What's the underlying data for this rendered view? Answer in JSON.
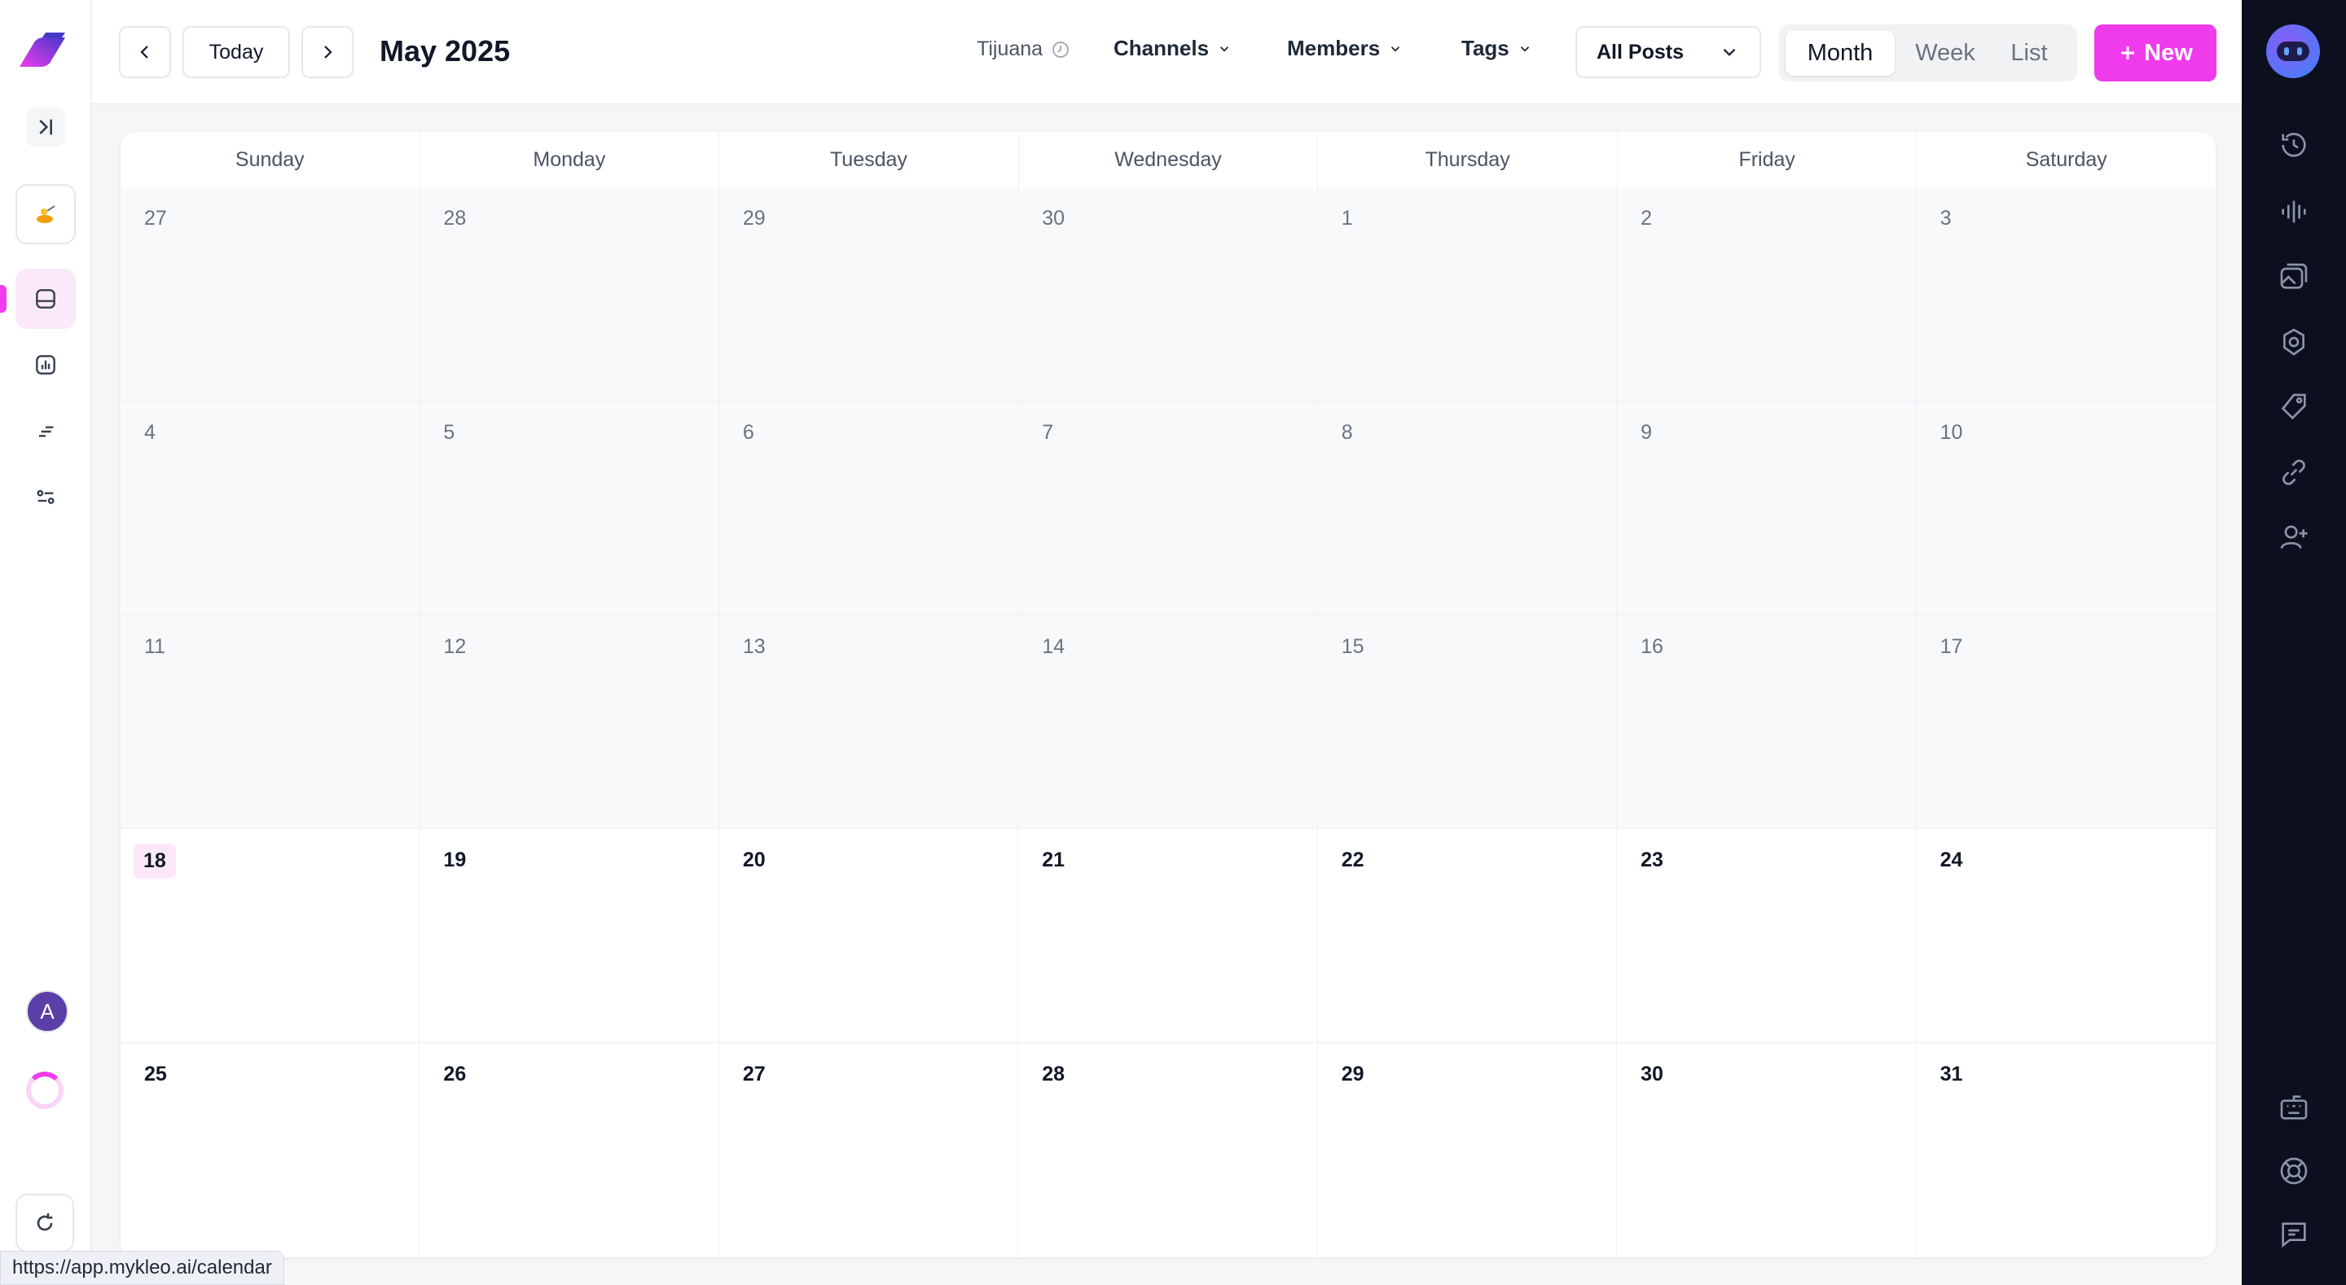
{
  "header": {
    "today_label": "Today",
    "month_title": "May 2025",
    "timezone": "Tijuana",
    "filters": {
      "channels": "Channels",
      "members": "Members",
      "tags": "Tags"
    },
    "post_filter": "All Posts",
    "views": [
      "Month",
      "Week",
      "List"
    ],
    "active_view": "Month",
    "new_button": "New"
  },
  "calendar": {
    "weekdays": [
      "Sunday",
      "Monday",
      "Tuesday",
      "Wednesday",
      "Thursday",
      "Friday",
      "Saturday"
    ],
    "weeks": [
      [
        "27",
        "28",
        "29",
        "30",
        "1",
        "2",
        "3"
      ],
      [
        "4",
        "5",
        "6",
        "7",
        "8",
        "9",
        "10"
      ],
      [
        "11",
        "12",
        "13",
        "14",
        "15",
        "16",
        "17"
      ],
      [
        "18",
        "19",
        "20",
        "21",
        "22",
        "23",
        "24"
      ],
      [
        "25",
        "26",
        "27",
        "28",
        "29",
        "30",
        "31"
      ]
    ],
    "today": "18"
  },
  "user": {
    "avatar_initial": "A"
  },
  "status_url": "https://app.mykleo.ai/calendar",
  "colors": {
    "accent": "#ef3bec",
    "right_bar": "#0c0f1d",
    "today_bg": "#fce7f9"
  }
}
